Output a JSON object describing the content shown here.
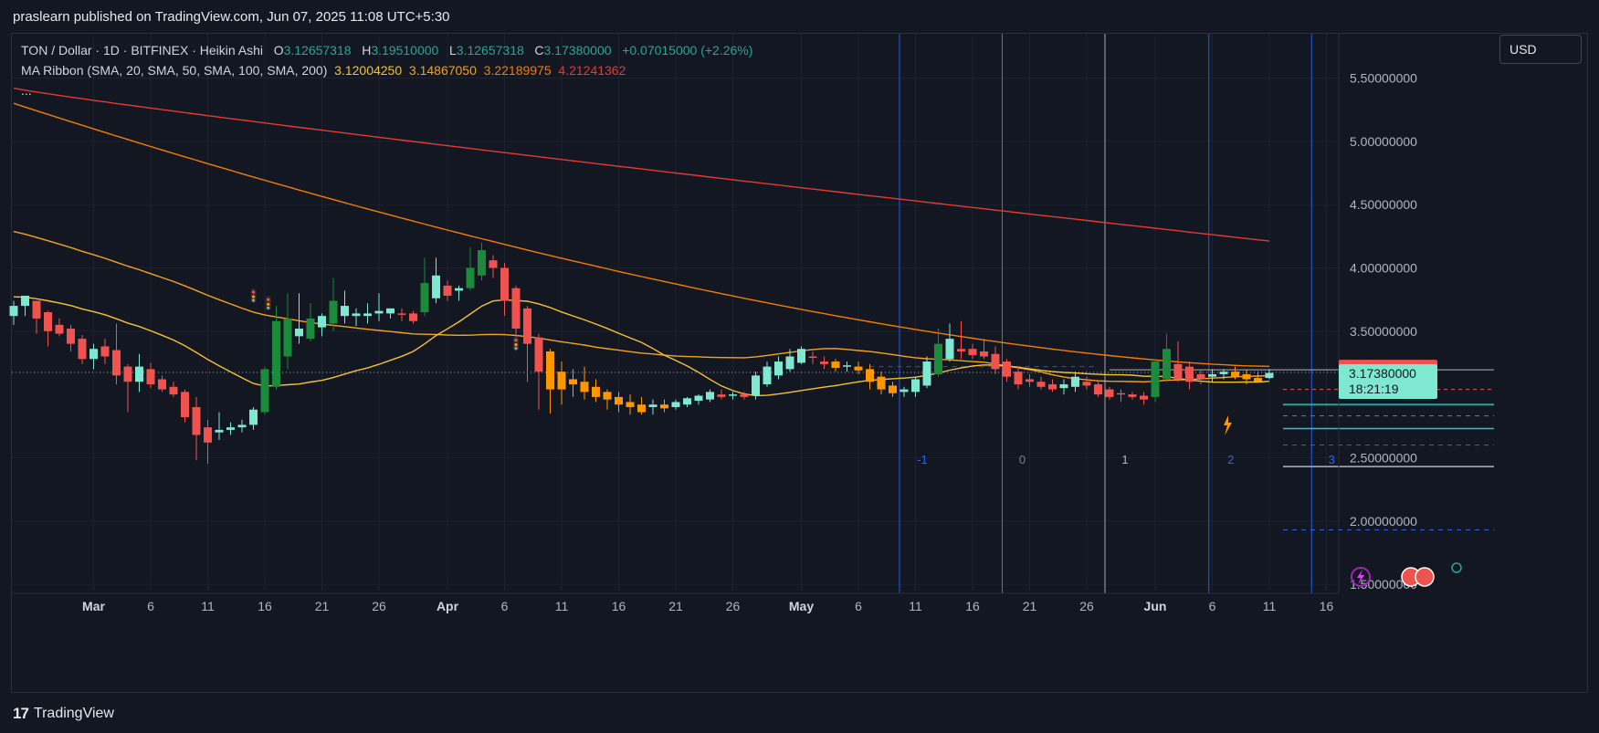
{
  "header": {
    "published": "praslearn published on TradingView.com, Jun 07, 2025 11:08 UTC+5:30"
  },
  "legend": {
    "symbol": "TON / Dollar · 1D · BITFINEX · Heikin Ashi",
    "o_label": "O",
    "o": "3.12657318",
    "h_label": "H",
    "h": "3.19510000",
    "l_label": "L",
    "l": "3.12657318",
    "c_label": "C",
    "c": "3.17380000",
    "change": "+0.07015000 (+2.26%)",
    "ma_title": "MA Ribbon (SMA, 20, SMA, 50, SMA, 100, SMA, 200)",
    "ma_values": [
      "3.12004250",
      "3.14867050",
      "3.22189975",
      "4.21241362"
    ],
    "more": "..."
  },
  "currency_button": "USD",
  "footer": {
    "brand": "TradingView",
    "brand_mark": "17"
  },
  "colors": {
    "bg": "#131722",
    "up": "#26a69a",
    "down": "#ef5350",
    "grid": "#1e222d",
    "ma20": "#f5c230",
    "ma50": "#f7a21b",
    "ma100": "#f57c00",
    "ma200": "#e53935"
  },
  "chart_data": {
    "type": "candlestick",
    "style": "Heikin Ashi",
    "y_ticks": [
      "5.50000000",
      "5.00000000",
      "4.50000000",
      "4.00000000",
      "3.50000000",
      "2.50000000",
      "2.00000000",
      "1.50000000"
    ],
    "x_ticks": [
      {
        "label": "Mar",
        "bold": true
      },
      {
        "label": "6"
      },
      {
        "label": "11"
      },
      {
        "label": "16"
      },
      {
        "label": "21"
      },
      {
        "label": "26"
      },
      {
        "label": "Apr",
        "bold": true
      },
      {
        "label": "6"
      },
      {
        "label": "11"
      },
      {
        "label": "16"
      },
      {
        "label": "21"
      },
      {
        "label": "26"
      },
      {
        "label": "May",
        "bold": true
      },
      {
        "label": "6"
      },
      {
        "label": "11"
      },
      {
        "label": "16"
      },
      {
        "label": "21"
      },
      {
        "label": "26"
      },
      {
        "label": "Jun",
        "bold": true
      },
      {
        "label": "6"
      },
      {
        "label": "11"
      },
      {
        "label": "16"
      }
    ],
    "ylim": [
      1.45,
      5.85
    ],
    "price_labels": {
      "high": "3.19510000",
      "last": "3.17380000",
      "countdown": "18:21:19"
    },
    "last_price": 3.1738,
    "high_price": 3.1951,
    "cycle_labels": [
      "-1",
      "0",
      "1",
      "2",
      "3"
    ],
    "fib_levels": [
      2.92,
      2.83,
      2.73,
      2.6,
      2.43,
      1.93,
      3.04
    ],
    "candles": [
      {
        "o": 3.62,
        "h": 3.74,
        "l": 3.55,
        "c": 3.7
      },
      {
        "o": 3.7,
        "h": 3.78,
        "l": 3.62,
        "c": 3.78
      },
      {
        "o": 3.74,
        "h": 3.74,
        "l": 3.48,
        "c": 3.6
      },
      {
        "o": 3.65,
        "h": 3.66,
        "l": 3.38,
        "c": 3.5
      },
      {
        "o": 3.55,
        "h": 3.6,
        "l": 3.46,
        "c": 3.48
      },
      {
        "o": 3.52,
        "h": 3.55,
        "l": 3.34,
        "c": 3.4
      },
      {
        "o": 3.44,
        "h": 3.47,
        "l": 3.24,
        "c": 3.28
      },
      {
        "o": 3.28,
        "h": 3.4,
        "l": 3.2,
        "c": 3.36
      },
      {
        "o": 3.38,
        "h": 3.44,
        "l": 3.24,
        "c": 3.3
      },
      {
        "o": 3.35,
        "h": 3.56,
        "l": 3.08,
        "c": 3.15
      },
      {
        "o": 3.22,
        "h": 3.24,
        "l": 2.86,
        "c": 3.1
      },
      {
        "o": 3.1,
        "h": 3.32,
        "l": 3.02,
        "c": 3.22
      },
      {
        "o": 3.2,
        "h": 3.25,
        "l": 3.05,
        "c": 3.08
      },
      {
        "o": 3.12,
        "h": 3.15,
        "l": 3.02,
        "c": 3.04
      },
      {
        "o": 3.06,
        "h": 3.1,
        "l": 2.98,
        "c": 3.0
      },
      {
        "o": 3.02,
        "h": 3.04,
        "l": 2.78,
        "c": 2.82
      },
      {
        "o": 2.9,
        "h": 2.98,
        "l": 2.48,
        "c": 2.68
      },
      {
        "o": 2.74,
        "h": 2.8,
        "l": 2.45,
        "c": 2.62
      },
      {
        "o": 2.7,
        "h": 2.86,
        "l": 2.64,
        "c": 2.72
      },
      {
        "o": 2.72,
        "h": 2.78,
        "l": 2.68,
        "c": 2.74
      },
      {
        "o": 2.74,
        "h": 2.8,
        "l": 2.7,
        "c": 2.76
      },
      {
        "o": 2.76,
        "h": 2.9,
        "l": 2.72,
        "c": 2.88
      },
      {
        "o": 2.86,
        "h": 3.22,
        "l": 2.84,
        "c": 3.2
      },
      {
        "o": 3.06,
        "h": 3.7,
        "l": 3.04,
        "c": 3.58
      },
      {
        "o": 3.3,
        "h": 3.8,
        "l": 3.2,
        "c": 3.6
      },
      {
        "o": 3.46,
        "h": 3.8,
        "l": 3.4,
        "c": 3.52
      },
      {
        "o": 3.44,
        "h": 3.72,
        "l": 3.42,
        "c": 3.6
      },
      {
        "o": 3.53,
        "h": 3.64,
        "l": 3.46,
        "c": 3.62
      },
      {
        "o": 3.56,
        "h": 3.92,
        "l": 3.5,
        "c": 3.74
      },
      {
        "o": 3.62,
        "h": 3.82,
        "l": 3.56,
        "c": 3.7
      },
      {
        "o": 3.62,
        "h": 3.68,
        "l": 3.54,
        "c": 3.64
      },
      {
        "o": 3.62,
        "h": 3.72,
        "l": 3.56,
        "c": 3.64
      },
      {
        "o": 3.64,
        "h": 3.8,
        "l": 3.58,
        "c": 3.66
      },
      {
        "o": 3.64,
        "h": 3.68,
        "l": 3.6,
        "c": 3.68
      },
      {
        "o": 3.64,
        "h": 3.68,
        "l": 3.58,
        "c": 3.63
      },
      {
        "o": 3.64,
        "h": 3.66,
        "l": 3.56,
        "c": 3.58
      },
      {
        "o": 3.65,
        "h": 4.08,
        "l": 3.62,
        "c": 3.88
      },
      {
        "o": 3.76,
        "h": 4.08,
        "l": 3.72,
        "c": 3.94
      },
      {
        "o": 3.86,
        "h": 3.9,
        "l": 3.74,
        "c": 3.78
      },
      {
        "o": 3.82,
        "h": 3.86,
        "l": 3.74,
        "c": 3.84
      },
      {
        "o": 3.84,
        "h": 4.16,
        "l": 3.82,
        "c": 4.0
      },
      {
        "o": 3.94,
        "h": 4.2,
        "l": 3.9,
        "c": 4.14
      },
      {
        "o": 4.06,
        "h": 4.1,
        "l": 3.92,
        "c": 4.0
      },
      {
        "o": 4.0,
        "h": 4.04,
        "l": 3.62,
        "c": 3.74
      },
      {
        "o": 3.84,
        "h": 3.86,
        "l": 3.4,
        "c": 3.52
      },
      {
        "o": 3.68,
        "h": 3.7,
        "l": 3.1,
        "c": 3.4
      },
      {
        "o": 3.45,
        "h": 3.48,
        "l": 2.88,
        "c": 3.18
      },
      {
        "o": 3.34,
        "h": 3.36,
        "l": 2.85,
        "c": 3.04
      },
      {
        "o": 3.18,
        "h": 3.26,
        "l": 2.92,
        "c": 3.04
      },
      {
        "o": 3.12,
        "h": 3.2,
        "l": 2.98,
        "c": 3.08
      },
      {
        "o": 3.1,
        "h": 3.22,
        "l": 2.96,
        "c": 3.02
      },
      {
        "o": 3.06,
        "h": 3.12,
        "l": 2.94,
        "c": 2.98
      },
      {
        "o": 3.02,
        "h": 3.04,
        "l": 2.88,
        "c": 2.96
      },
      {
        "o": 2.98,
        "h": 3.02,
        "l": 2.86,
        "c": 2.92
      },
      {
        "o": 2.94,
        "h": 3.0,
        "l": 2.84,
        "c": 2.9
      },
      {
        "o": 2.92,
        "h": 2.98,
        "l": 2.84,
        "c": 2.86
      },
      {
        "o": 2.9,
        "h": 2.96,
        "l": 2.84,
        "c": 2.92
      },
      {
        "o": 2.92,
        "h": 2.96,
        "l": 2.86,
        "c": 2.89
      },
      {
        "o": 2.9,
        "h": 2.96,
        "l": 2.88,
        "c": 2.94
      },
      {
        "o": 2.92,
        "h": 2.98,
        "l": 2.9,
        "c": 2.97
      },
      {
        "o": 2.95,
        "h": 3.0,
        "l": 2.92,
        "c": 2.99
      },
      {
        "o": 2.96,
        "h": 3.04,
        "l": 2.94,
        "c": 3.02
      },
      {
        "o": 3.0,
        "h": 3.04,
        "l": 2.96,
        "c": 2.98
      },
      {
        "o": 2.99,
        "h": 3.02,
        "l": 2.96,
        "c": 3.0
      },
      {
        "o": 3.0,
        "h": 3.02,
        "l": 2.96,
        "c": 2.98
      },
      {
        "o": 2.99,
        "h": 3.18,
        "l": 2.96,
        "c": 3.15
      },
      {
        "o": 3.08,
        "h": 3.26,
        "l": 3.06,
        "c": 3.22
      },
      {
        "o": 3.15,
        "h": 3.3,
        "l": 3.12,
        "c": 3.26
      },
      {
        "o": 3.2,
        "h": 3.36,
        "l": 3.18,
        "c": 3.3
      },
      {
        "o": 3.25,
        "h": 3.38,
        "l": 3.24,
        "c": 3.36
      },
      {
        "o": 3.3,
        "h": 3.34,
        "l": 3.24,
        "c": 3.29
      },
      {
        "o": 3.26,
        "h": 3.3,
        "l": 3.2,
        "c": 3.24
      },
      {
        "o": 3.26,
        "h": 3.28,
        "l": 3.18,
        "c": 3.21
      },
      {
        "o": 3.22,
        "h": 3.26,
        "l": 3.18,
        "c": 3.23
      },
      {
        "o": 3.22,
        "h": 3.26,
        "l": 3.16,
        "c": 3.19
      },
      {
        "o": 3.2,
        "h": 3.24,
        "l": 3.04,
        "c": 3.1
      },
      {
        "o": 3.14,
        "h": 3.18,
        "l": 3.0,
        "c": 3.04
      },
      {
        "o": 3.07,
        "h": 3.1,
        "l": 2.98,
        "c": 3.01
      },
      {
        "o": 3.02,
        "h": 3.06,
        "l": 2.98,
        "c": 3.04
      },
      {
        "o": 3.02,
        "h": 3.14,
        "l": 2.98,
        "c": 3.12
      },
      {
        "o": 3.07,
        "h": 3.3,
        "l": 3.05,
        "c": 3.26
      },
      {
        "o": 3.16,
        "h": 3.52,
        "l": 3.14,
        "c": 3.4
      },
      {
        "o": 3.28,
        "h": 3.56,
        "l": 3.26,
        "c": 3.44
      },
      {
        "o": 3.36,
        "h": 3.58,
        "l": 3.28,
        "c": 3.34
      },
      {
        "o": 3.36,
        "h": 3.4,
        "l": 3.28,
        "c": 3.31
      },
      {
        "o": 3.34,
        "h": 3.44,
        "l": 3.28,
        "c": 3.3
      },
      {
        "o": 3.32,
        "h": 3.38,
        "l": 3.16,
        "c": 3.2
      },
      {
        "o": 3.26,
        "h": 3.28,
        "l": 3.1,
        "c": 3.14
      },
      {
        "o": 3.18,
        "h": 3.22,
        "l": 3.04,
        "c": 3.08
      },
      {
        "o": 3.12,
        "h": 3.16,
        "l": 3.06,
        "c": 3.1
      },
      {
        "o": 3.1,
        "h": 3.14,
        "l": 3.04,
        "c": 3.06
      },
      {
        "o": 3.08,
        "h": 3.12,
        "l": 3.02,
        "c": 3.04
      },
      {
        "o": 3.05,
        "h": 3.12,
        "l": 3.0,
        "c": 3.08
      },
      {
        "o": 3.06,
        "h": 3.18,
        "l": 3.02,
        "c": 3.14
      },
      {
        "o": 3.1,
        "h": 3.14,
        "l": 3.04,
        "c": 3.07
      },
      {
        "o": 3.08,
        "h": 3.1,
        "l": 2.98,
        "c": 3.0
      },
      {
        "o": 3.04,
        "h": 3.06,
        "l": 2.96,
        "c": 2.98
      },
      {
        "o": 3.01,
        "h": 3.04,
        "l": 2.94,
        "c": 3.0
      },
      {
        "o": 3.0,
        "h": 3.02,
        "l": 2.96,
        "c": 2.98
      },
      {
        "o": 2.99,
        "h": 3.02,
        "l": 2.92,
        "c": 2.96
      },
      {
        "o": 2.98,
        "h": 3.28,
        "l": 2.94,
        "c": 3.26
      },
      {
        "o": 3.12,
        "h": 3.48,
        "l": 3.1,
        "c": 3.36
      },
      {
        "o": 3.24,
        "h": 3.42,
        "l": 3.1,
        "c": 3.12
      },
      {
        "o": 3.22,
        "h": 3.26,
        "l": 3.04,
        "c": 3.1
      },
      {
        "o": 3.16,
        "h": 3.2,
        "l": 3.08,
        "c": 3.12
      },
      {
        "o": 3.14,
        "h": 3.2,
        "l": 3.1,
        "c": 3.16
      },
      {
        "o": 3.16,
        "h": 3.2,
        "l": 3.12,
        "c": 3.18
      },
      {
        "o": 3.18,
        "h": 3.22,
        "l": 3.12,
        "c": 3.14
      },
      {
        "o": 3.16,
        "h": 3.2,
        "l": 3.08,
        "c": 3.12
      },
      {
        "o": 3.13,
        "h": 3.18,
        "l": 3.1,
        "c": 3.1
      },
      {
        "o": 3.13,
        "h": 3.2,
        "l": 3.12,
        "c": 3.17
      }
    ]
  }
}
